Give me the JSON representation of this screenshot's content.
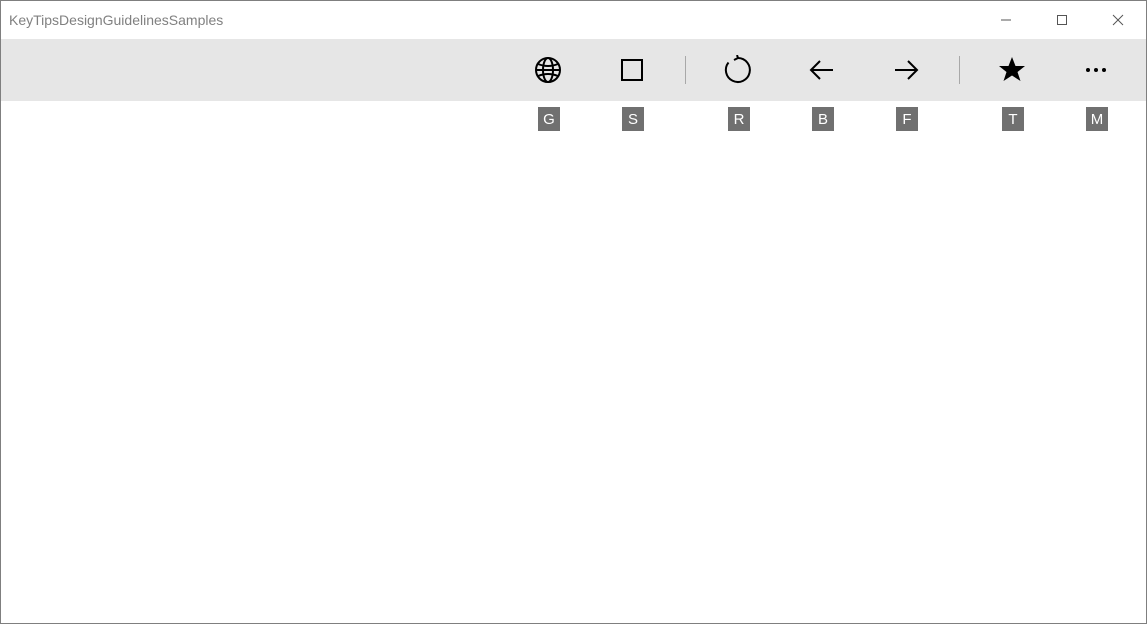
{
  "window": {
    "title": "KeyTipsDesignGuidelinesSamples"
  },
  "toolbar": {
    "items": [
      {
        "id": "globe",
        "keytip": "G"
      },
      {
        "id": "stop",
        "keytip": "S"
      },
      {
        "id": "refresh",
        "keytip": "R"
      },
      {
        "id": "back",
        "keytip": "B"
      },
      {
        "id": "forward",
        "keytip": "F"
      },
      {
        "id": "star",
        "keytip": "T"
      },
      {
        "id": "more",
        "keytip": "M"
      }
    ]
  }
}
